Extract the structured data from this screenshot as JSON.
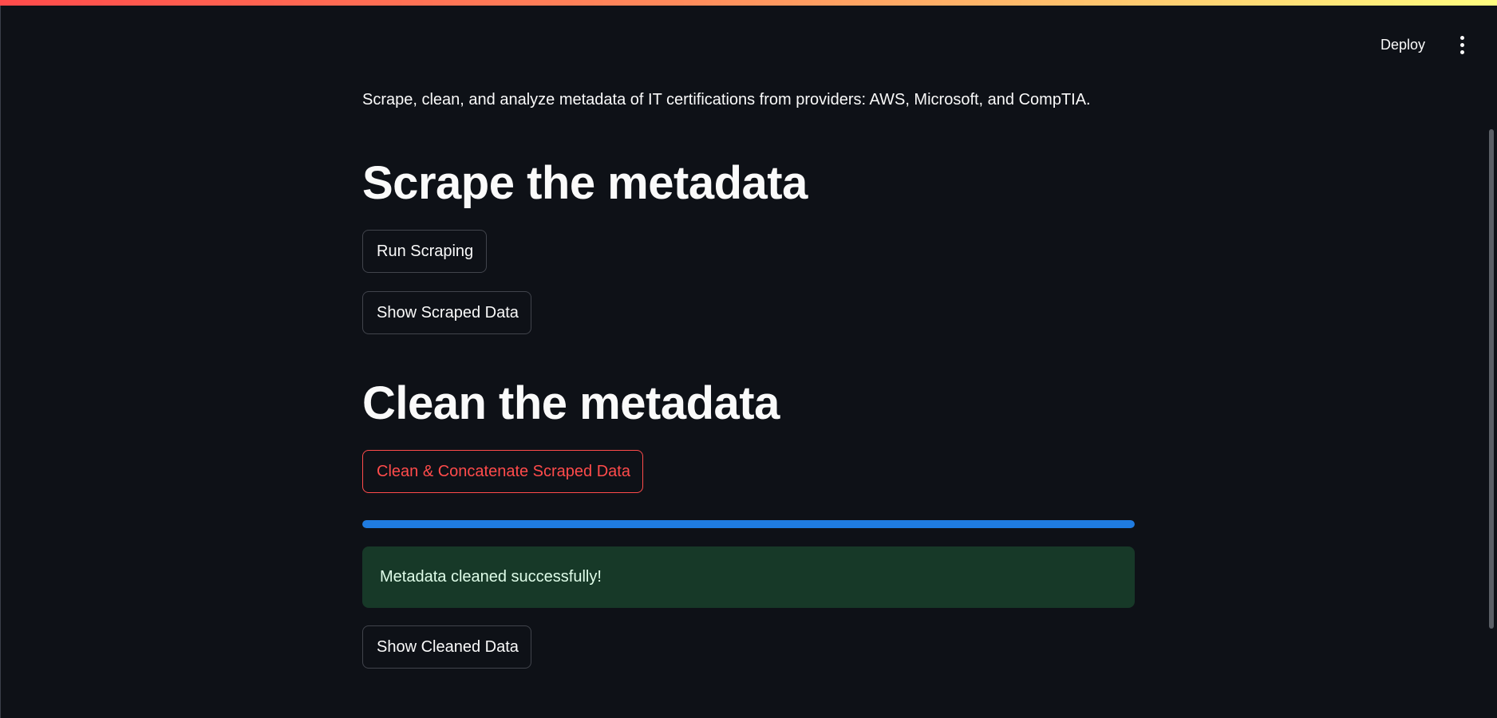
{
  "header": {
    "deploy_label": "Deploy",
    "menu_icon": "vertical-ellipsis-icon"
  },
  "intro": {
    "text": "Scrape, clean, and analyze metadata of IT certifications from providers: AWS, Microsoft, and CompTIA."
  },
  "scrape_section": {
    "title": "Scrape the metadata",
    "run_button": "Run Scraping",
    "show_button": "Show Scraped Data"
  },
  "clean_section": {
    "title": "Clean the metadata",
    "clean_button": "Clean & Concatenate Scraped Data",
    "progress": 1.0,
    "success_message": "Metadata cleaned successfully!",
    "show_button": "Show Cleaned Data"
  },
  "colors": {
    "background": "#0e1117",
    "text": "#fafafa",
    "primary_accent": "#ff4b4b",
    "progress": "#1f7be0",
    "success_bg": "#173928",
    "success_text": "#dffde9"
  }
}
